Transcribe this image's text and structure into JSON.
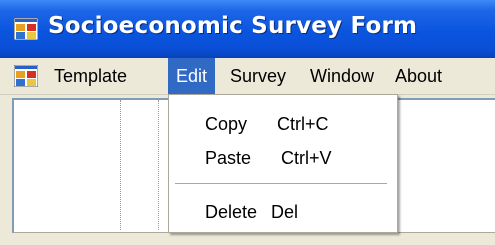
{
  "window": {
    "title": "Socioeconomic Survey Form",
    "app_icon": "app-form-icon"
  },
  "menubar": {
    "items": [
      {
        "label": "Template"
      },
      {
        "label": "Edit",
        "active": true
      },
      {
        "label": "Survey"
      },
      {
        "label": "Window"
      },
      {
        "label": "About"
      }
    ]
  },
  "edit_menu": {
    "items": [
      {
        "label": "Copy",
        "shortcut": "Ctrl+C"
      },
      {
        "label": "Paste",
        "shortcut": "Ctrl+V"
      },
      {
        "label": "Delete",
        "shortcut": "Del"
      }
    ]
  },
  "colors": {
    "titlebar": "#0A55DE",
    "menu_highlight": "#316AC5",
    "background": "#ECE9D8"
  }
}
